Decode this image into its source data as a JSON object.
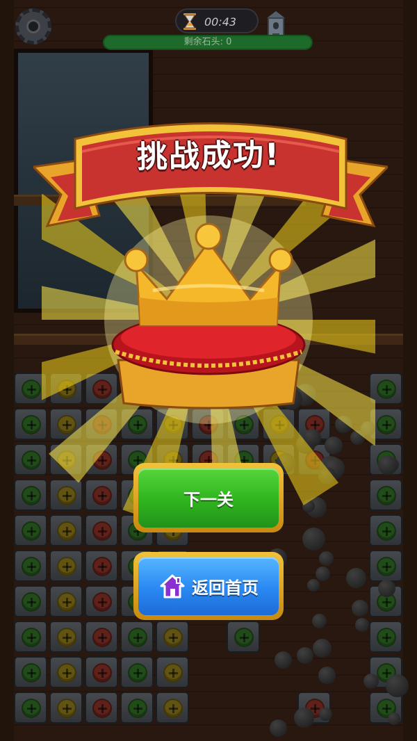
{
  "hud": {
    "timer": "00:43",
    "remaining_stones": "剩余石头: 0"
  },
  "result": {
    "title": "挑战成功!"
  },
  "buttons": {
    "next_level": "下一关",
    "return_home": "返回首页"
  },
  "colors": {
    "banner_red": "#c8332f",
    "gold": "#f2c23a",
    "next_green": "#2fb41e",
    "home_blue": "#2a88f2",
    "screw_colors": [
      "#4aa83a",
      "#d24a3a",
      "#d8b826"
    ]
  },
  "icons": [
    "gear-icon",
    "hourglass-icon",
    "tower-icon",
    "crown-icon",
    "house-icon"
  ]
}
